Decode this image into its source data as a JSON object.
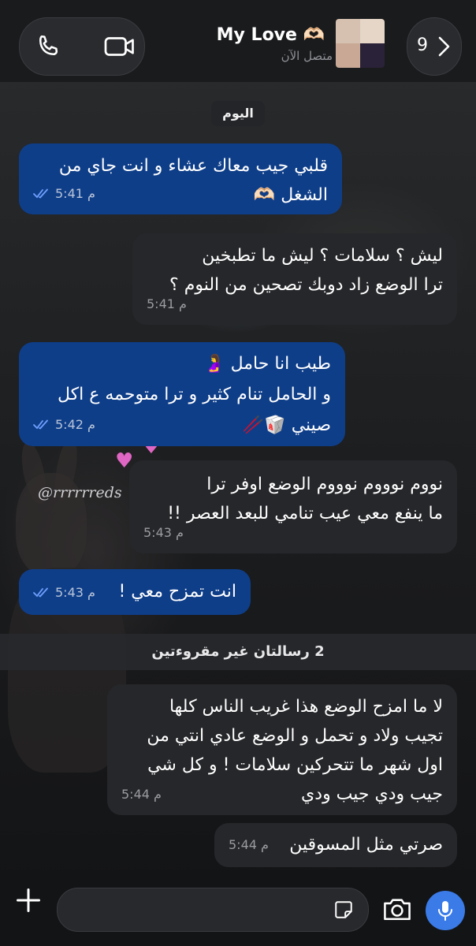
{
  "header": {
    "contact_name": "My Love 🫶🏻",
    "status": "متصل الآن",
    "unread_count": "9",
    "icons": [
      "phone-icon",
      "video-camera-icon",
      "chevron-right-icon"
    ]
  },
  "day_label": "اليوم",
  "watermark": "@rrrrrreds",
  "messages": [
    {
      "direction": "outgoing",
      "text": "قلبي جيب معاك عشاء و انت جاي من\nالشغل 🫶🏻",
      "time": "5:41 م",
      "read": true
    },
    {
      "direction": "incoming",
      "text": "ليش ؟ سلامات ؟ ليش ما تطبخين\nترا الوضع زاد دوبك تصحين من النوم ؟",
      "time": "5:41 م"
    },
    {
      "direction": "outgoing",
      "text": "طيب انا حامل 🤰\nو الحامل تنام كثير و ترا متوحمه ع اكل\nصيني 🥡🥢",
      "time": "5:42 م",
      "read": true
    },
    {
      "direction": "incoming",
      "text": "نووم نوووم نوووم الوضع اوفر ترا\nما ينفع معي عيب تنامي للبعد العصر !!",
      "time": "5:43 م"
    },
    {
      "direction": "outgoing",
      "text": "انت تمزح معي !",
      "time": "5:43 م",
      "read": true
    },
    {
      "direction": "incoming",
      "text": "لا ما امزح الوضع هذا غريب الناس كلها\nتجيب ولاد و تحمل و الوضع عادي انتي من\nاول شهر ما تتحركين سلامات ! و كل شي\nجيب ودي جيب ودي",
      "time": "5:44 م"
    },
    {
      "direction": "incoming",
      "text": "صرتي مثل المسوقين",
      "time": "5:44 م"
    }
  ],
  "unread_separator": "2 رسالتان غير مقروءتين",
  "composer": {
    "placeholder": "",
    "icons": [
      "plus-icon",
      "sticker-icon",
      "camera-icon",
      "microphone-icon"
    ]
  },
  "colors": {
    "outgoing_bubble": "#0f3e89",
    "incoming_bubble": "#26272a",
    "accent": "#3a7be8",
    "read_ticks": "#6ea0ff"
  }
}
